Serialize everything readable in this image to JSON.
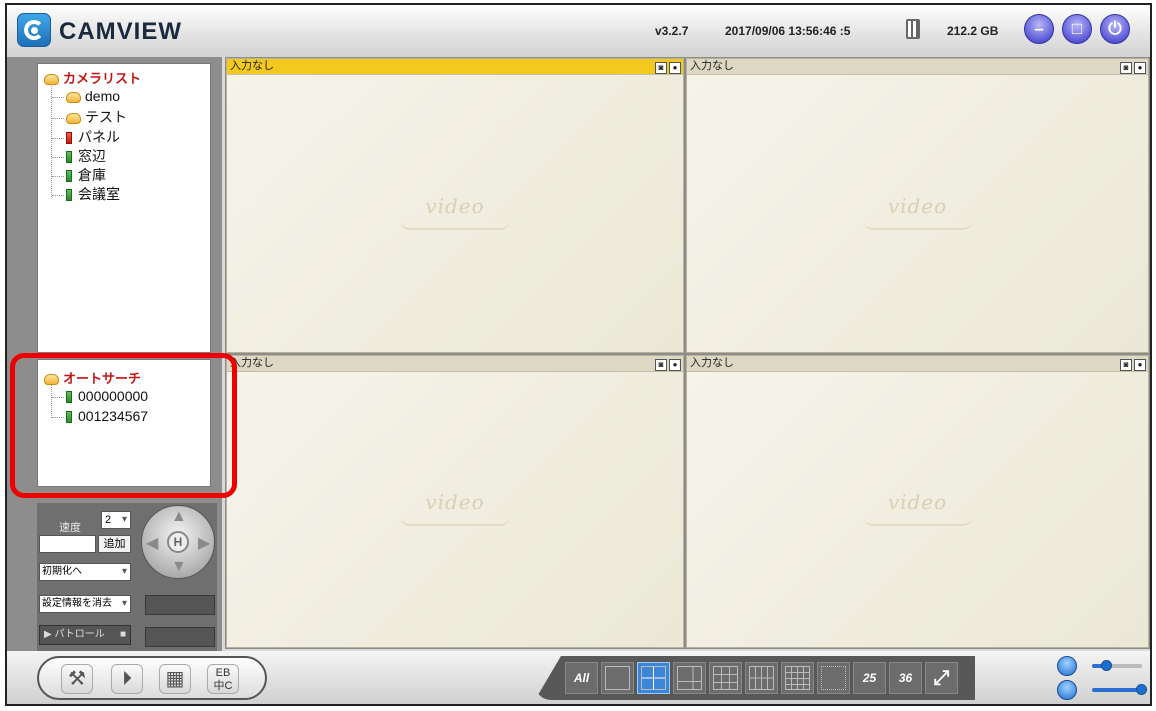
{
  "header": {
    "app_title": "CAMVIEW",
    "version": "v3.2.7",
    "datetime": "2017/09/06 13:56:46 :5",
    "disk_free": "212.2 GB",
    "buttons": [
      "minimize-icon",
      "restore-icon",
      "power-icon"
    ]
  },
  "camera_tree": {
    "root": "カメラリスト",
    "items": [
      {
        "label": "demo",
        "icon": "folder-icon"
      },
      {
        "label": "テスト",
        "icon": "folder-icon"
      },
      {
        "label": "パネル",
        "icon": "camera-offline-icon"
      },
      {
        "label": "窓辺",
        "icon": "camera-icon"
      },
      {
        "label": "倉庫",
        "icon": "camera-icon"
      },
      {
        "label": "会議室",
        "icon": "camera-icon"
      }
    ]
  },
  "auto_search": {
    "root": "オートサーチ",
    "items": [
      {
        "label": "000000000"
      },
      {
        "label": "001234567"
      }
    ]
  },
  "ptz": {
    "speed_label": "速度",
    "speed_value": "2",
    "add_label": "追加",
    "preset_placeholder": "初期化へ",
    "clear_placeholder": "設定情報を消去",
    "patrol_label": "パトロール",
    "home_label": "H"
  },
  "video_panes": [
    {
      "status": "入力なし",
      "watermark": "video",
      "active": true
    },
    {
      "status": "入力なし",
      "watermark": "video",
      "active": false
    },
    {
      "status": "入力なし",
      "watermark": "video",
      "active": false
    },
    {
      "status": "入力なし",
      "watermark": "video",
      "active": false
    }
  ],
  "toolbar": {
    "language_label_top": "EB",
    "language_label_bottom": "中C",
    "layout_all": "All",
    "layout_25": "25",
    "layout_36": "36"
  },
  "audio": {
    "mic_level": 0.3,
    "speaker_level": 1.0
  },
  "colors": {
    "active_pane_bar": "#f2c91c",
    "selected_layout": "#3b86d6",
    "highlight": "#ee0000"
  }
}
